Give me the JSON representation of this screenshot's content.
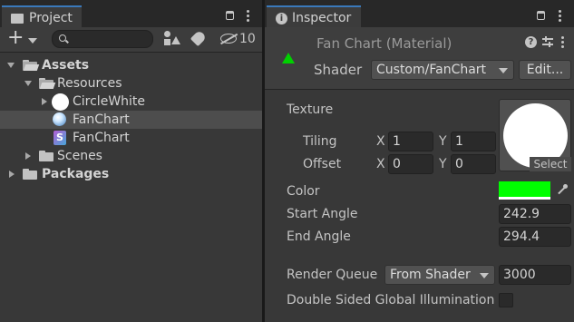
{
  "project": {
    "tab_title": "Project",
    "add_label": "+",
    "search": {
      "value": "",
      "placeholder": ""
    },
    "hidden_count": "10",
    "tree": {
      "assets": "Assets",
      "resources": "Resources",
      "circle_white": "CircleWhite",
      "fanchart_material": "FanChart",
      "fanchart_shader": "FanChart",
      "scenes": "Scenes",
      "packages": "Packages"
    }
  },
  "inspector": {
    "tab_title": "Inspector",
    "asset_title": "Fan Chart (Material)",
    "shader_label": "Shader",
    "shader_value": "Custom/FanChart",
    "edit_button": "Edit...",
    "texture": {
      "label": "Texture",
      "select_button": "Select",
      "tiling_label": "Tiling",
      "offset_label": "Offset",
      "x_label": "X",
      "y_label": "Y",
      "tiling_x": "1",
      "tiling_y": "1",
      "offset_x": "0",
      "offset_y": "0"
    },
    "color_label": "Color",
    "color_value": "#00ff00",
    "start_angle_label": "Start Angle",
    "start_angle": "242.9",
    "end_angle_label": "End Angle",
    "end_angle": "294.4",
    "render_queue_label": "Render Queue",
    "render_queue_mode": "From Shader",
    "render_queue_value": "3000",
    "double_sided_label": "Double Sided Global Illumination",
    "double_sided_checked": false
  },
  "colors": {
    "accent": "#3a79bb",
    "selection": "#4d4d4d",
    "panel": "#383838",
    "tab_strip": "#282828"
  }
}
